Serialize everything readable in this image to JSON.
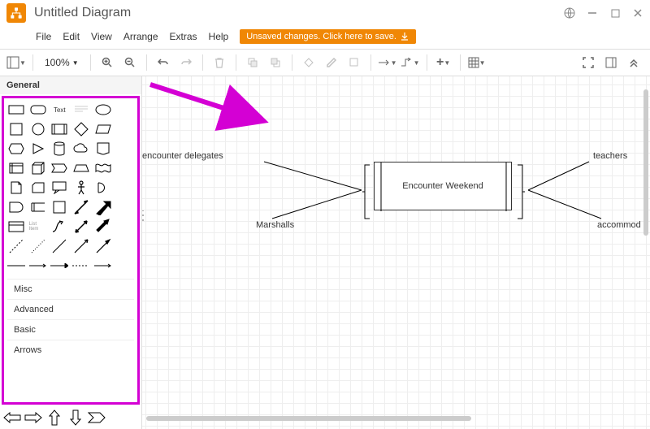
{
  "title": "Untitled Diagram",
  "menus": {
    "file": "File",
    "edit": "Edit",
    "view": "View",
    "arrange": "Arrange",
    "extras": "Extras",
    "help": "Help"
  },
  "banner": "Unsaved changes. Click here to save.",
  "zoom": "100%",
  "sidebar": {
    "general": "General",
    "categories": {
      "misc": "Misc",
      "advanced": "Advanced",
      "basic": "Basic",
      "arrows": "Arrows"
    },
    "text_shape": "Text"
  },
  "diagram": {
    "center": "Encounter Weekend",
    "left_top": "encounter delegates",
    "left_bottom": "Marshalls",
    "right_top": "teachers",
    "right_bottom": "accommod"
  }
}
